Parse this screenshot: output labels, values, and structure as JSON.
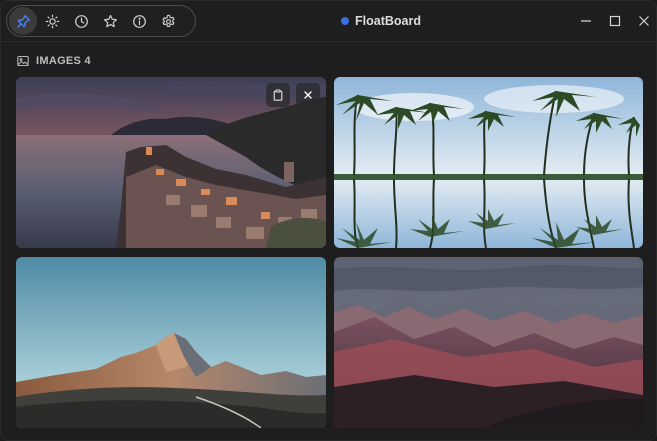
{
  "app": {
    "title": "FloatBoard",
    "status_color": "#3b6fe0"
  },
  "toolbar": {
    "buttons": [
      {
        "icon": "pin-icon",
        "active": true
      },
      {
        "icon": "sun-icon",
        "active": false
      },
      {
        "icon": "clock-icon",
        "active": false
      },
      {
        "icon": "star-icon",
        "active": false
      },
      {
        "icon": "info-icon",
        "active": false
      },
      {
        "icon": "gear-icon",
        "active": false
      }
    ],
    "active_color": "#4a7ff0"
  },
  "window_controls": [
    "minimize-icon",
    "maximize-icon",
    "close-icon"
  ],
  "section": {
    "icon": "image-icon",
    "label": "IMAGES 4"
  },
  "images": [
    {
      "subject": "coastal village at sunset",
      "actions": [
        "copy-icon",
        "close-icon"
      ]
    },
    {
      "subject": "palm trees reflected in water",
      "actions": []
    },
    {
      "subject": "rocky mountain peak at dusk",
      "actions": []
    },
    {
      "subject": "red mountain range under overcast sky",
      "actions": []
    }
  ]
}
